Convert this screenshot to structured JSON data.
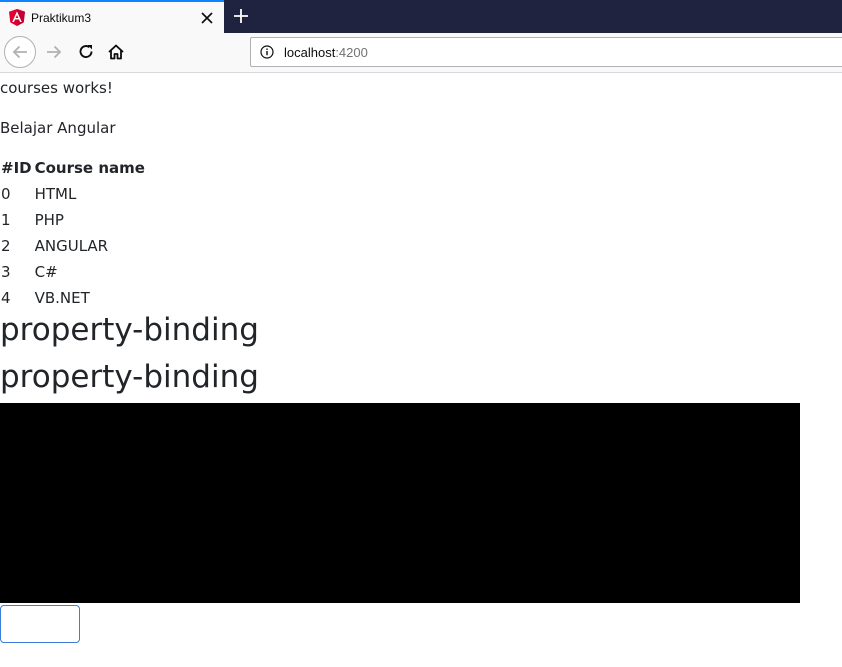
{
  "browser": {
    "tab": {
      "title": "Praktikum3"
    },
    "address": {
      "host": "localhost",
      "port": ":4200"
    }
  },
  "page": {
    "heading_text": "courses works!",
    "subtitle": "Belajar Angular",
    "table": {
      "headers": [
        "#ID",
        "Course name"
      ],
      "rows": [
        [
          "0",
          "HTML"
        ],
        [
          "1",
          "PHP"
        ],
        [
          "2",
          "ANGULAR"
        ],
        [
          "3",
          "C#"
        ],
        [
          "4",
          "VB.NET"
        ]
      ]
    },
    "big_headings": [
      "property-binding",
      "property-binding"
    ],
    "input": {
      "value": ""
    }
  },
  "colors": {
    "tab_accent": "#0a84ff",
    "tabbar_bg": "#202340",
    "angular_red": "#dd0031",
    "black_box": "#000000",
    "input_border": "#3b7dd8"
  }
}
